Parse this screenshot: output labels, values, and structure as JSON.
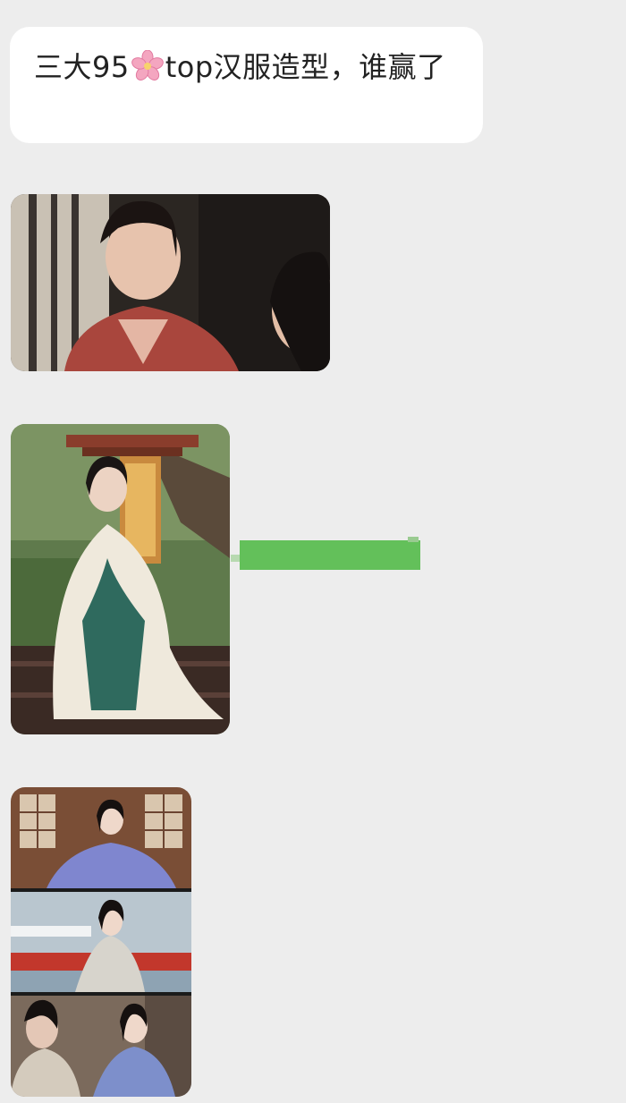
{
  "message": {
    "text_before": "三大95",
    "emoji": "cherry-blossom",
    "text_after": "top汉服造型，谁赢了"
  },
  "colors": {
    "background": "#ededed",
    "bubble": "#ffffff",
    "green_bar": "#63c05a"
  },
  "images": [
    {
      "id": "photo-1",
      "subject": "woman-in-red-hanfu"
    },
    {
      "id": "photo-2",
      "subject": "woman-in-white-green-hanfu"
    },
    {
      "id": "photo-3",
      "subject": "collage-blue-hanfu"
    }
  ]
}
